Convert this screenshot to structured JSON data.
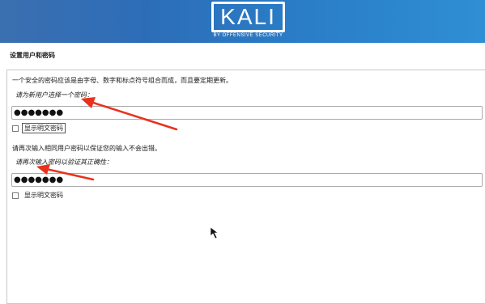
{
  "header": {
    "logo_text": "KALI",
    "logo_subtitle": "BY OFFENSIVE SECURITY"
  },
  "page": {
    "title": "设置用户和密码"
  },
  "form": {
    "description": "一个安全的密码应该是由字母、数字和标点符号组合而成，而且要定期更新。",
    "password_prompt": "请为新用户选择一个密码：",
    "password_value": "●●●●●●●",
    "show_password_1": "显示明文密码",
    "reenter_description": "请再次输入相同用户密码以保证您的输入不会出错。",
    "confirm_prompt": "请再次输入密码以验证其正确性：",
    "confirm_value": "●●●●●●●",
    "show_password_2": "显示明文密码"
  },
  "annotations": {
    "arrow_color": "#e8321e"
  }
}
